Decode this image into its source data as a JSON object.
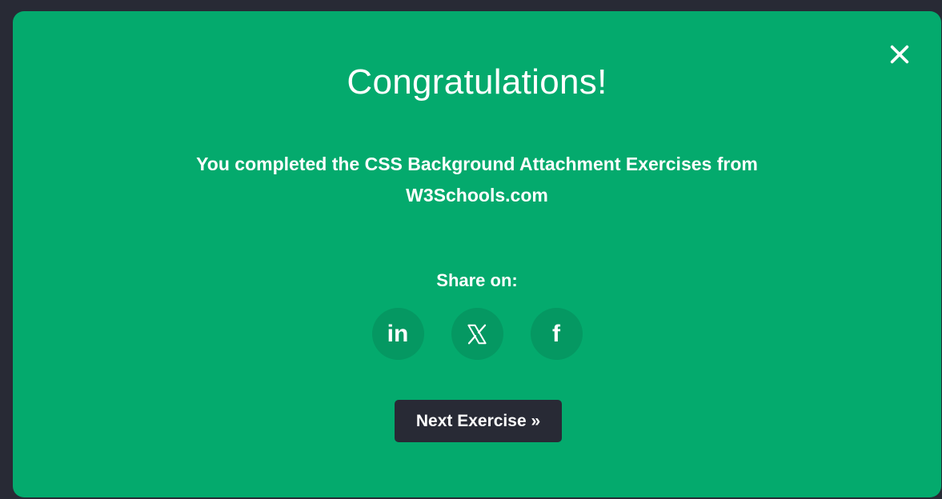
{
  "modal": {
    "title": "Congratulations!",
    "message": "You completed the CSS Background Attachment Exercises from W3Schools.com",
    "share_label": "Share on:",
    "share_buttons": [
      {
        "icon": "linkedin-icon",
        "glyph": "in"
      },
      {
        "icon": "x-twitter-icon",
        "glyph": "𝕏"
      },
      {
        "icon": "facebook-icon",
        "glyph": "f"
      }
    ],
    "next_label": "Next Exercise »",
    "close_icon": "close-icon"
  },
  "colors": {
    "modal_bg": "#04aa6d",
    "page_bg": "#282a35",
    "share_bg": "#059862",
    "next_bg": "#282a35",
    "text": "#ffffff"
  }
}
